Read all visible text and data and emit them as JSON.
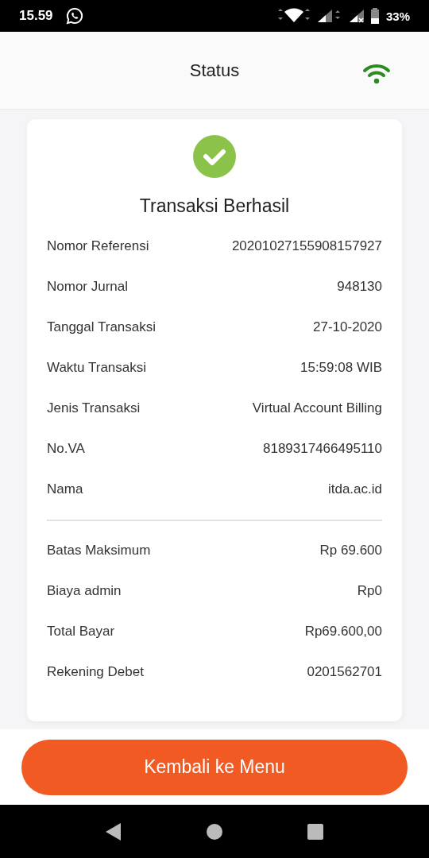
{
  "status_bar": {
    "time": "15.59",
    "battery": "33%"
  },
  "header": {
    "title": "Status"
  },
  "result": {
    "title": "Transaksi Berhasil"
  },
  "details": [
    {
      "label": "Nomor Referensi",
      "value": "20201027155908157927"
    },
    {
      "label": "Nomor Jurnal",
      "value": "948130"
    },
    {
      "label": "Tanggal Transaksi",
      "value": "27-10-2020"
    },
    {
      "label": "Waktu Transaksi",
      "value": "15:59:08 WIB"
    },
    {
      "label": "Jenis Transaksi",
      "value": "Virtual Account Billing"
    },
    {
      "label": "No.VA",
      "value": "8189317466495110"
    },
    {
      "label": "Nama",
      "value": "itda.ac.id"
    }
  ],
  "amounts": [
    {
      "label": "Batas Maksimum",
      "value": "Rp 69.600"
    },
    {
      "label": "Biaya admin",
      "value": "Rp0"
    },
    {
      "label": "Total Bayar",
      "value": "Rp69.600,00"
    },
    {
      "label": "Rekening Debet",
      "value": "0201562701"
    }
  ],
  "button": {
    "label": "Kembali ke Menu"
  }
}
